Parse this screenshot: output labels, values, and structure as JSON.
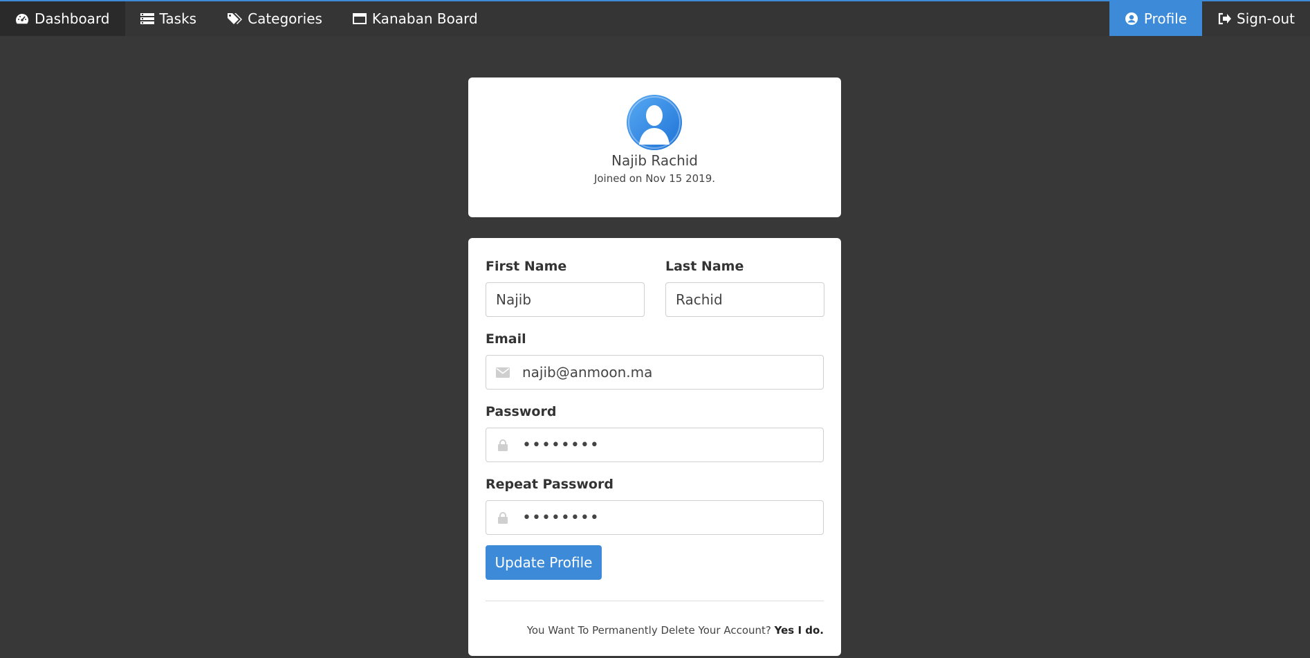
{
  "nav": {
    "left": [
      {
        "label": "Dashboard",
        "icon": "dashboard-icon"
      },
      {
        "label": "Tasks",
        "icon": "tasks-icon"
      },
      {
        "label": "Categories",
        "icon": "tags-icon"
      },
      {
        "label": "Kanaban Board",
        "icon": "window-icon"
      }
    ],
    "right": [
      {
        "label": "Profile",
        "icon": "user-circle-icon"
      },
      {
        "label": "Sign-out",
        "icon": "sign-out-icon"
      }
    ]
  },
  "profile": {
    "name": "Najib Rachid",
    "joined": "Joined on Nov 15 2019."
  },
  "form": {
    "first_name_label": "First Name",
    "first_name_value": "Najib",
    "last_name_label": "Last Name",
    "last_name_value": "Rachid",
    "email_label": "Email",
    "email_value": "najib@anmoon.ma",
    "password_label": "Password",
    "password_value": "••••••••",
    "repeat_password_label": "Repeat Password",
    "repeat_password_value": "••••••••",
    "update_button": "Update Profile",
    "delete_prompt": "You Want To Permanently Delete Your Account?",
    "delete_link": "Yes I do."
  },
  "colors": {
    "accent": "#3d8bd8",
    "topbar": "#353535",
    "background": "#383838"
  }
}
